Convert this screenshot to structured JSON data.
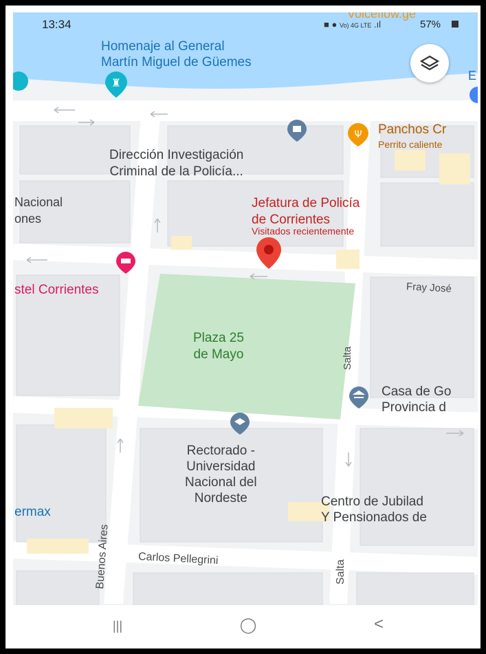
{
  "status_bar": {
    "time": "13:34",
    "network": "Vo) 4G LTE",
    "battery": "57%"
  },
  "map": {
    "top_banner_partial": "Voiceflow.ge",
    "places": {
      "monument": "Homenaje al General\nMartín Miguel de Güemes",
      "dic_police": "Dirección Investigación\nCriminal de la Policía...",
      "jefatura_name": "Jefatura de Policía\nde Corrientes",
      "jefatura_sub": "Visitados recientemente",
      "panchos_name": "Panchos Cr",
      "panchos_sub": "Perrito caliente",
      "hostel": "stel Corrientes",
      "nacional_left": "Nacional\nones",
      "plaza": "Plaza 25\nde Mayo",
      "casa_gob": "Casa de Go\nProvincia d",
      "rectorado": "Rectorado -\nUniversidad\nNacional del\nNordeste",
      "jubilados": "Centro de Jubilad\nY Pensionados de",
      "supermax": "ermax",
      "edge_e": "E"
    },
    "streets": {
      "fray_jose": "Fray José",
      "salta_upper": "Salta",
      "salta_lower": "Salta",
      "buenos_aires": "Buenos Aires",
      "carlos_pellegrini": "Carlos Pellegrini"
    },
    "colors": {
      "water": "#aadaff",
      "plaza": "#c8e6c9",
      "road": "#ffffff",
      "block": "#e8eaed",
      "pin": "#ea4335",
      "poi_blue": "#5f7fa0",
      "hotel_pink": "#e91e63",
      "food_orange": "#f29900",
      "hostel_text": "#d81b60",
      "jefatura_text": "#c5221f",
      "place_text": "#3c4043",
      "food_text": "#b06000"
    }
  },
  "nav_bar": {
    "recents": "|||",
    "home": "◯",
    "back": "<"
  }
}
